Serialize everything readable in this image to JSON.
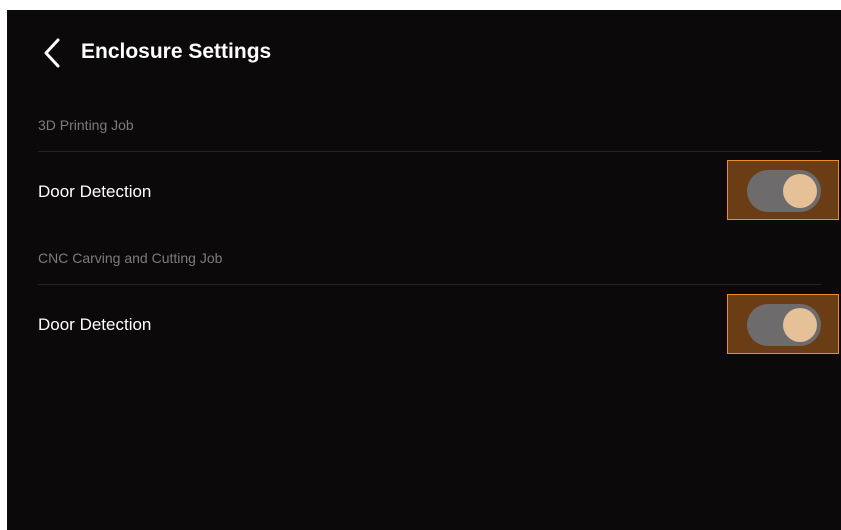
{
  "header": {
    "back_icon": "chevron-left-icon",
    "title": "Enclosure Settings"
  },
  "sections": [
    {
      "label": "3D Printing Job",
      "rows": [
        {
          "label": "Door Detection",
          "toggle_on": true
        }
      ]
    },
    {
      "label": "CNC Carving and Cutting Job",
      "rows": [
        {
          "label": "Door Detection",
          "toggle_on": true
        }
      ]
    }
  ],
  "colors": {
    "background": "#0b090a",
    "text_primary": "#ffffff",
    "text_secondary": "#7d7b7c",
    "toggle_track": "#6e6b6c",
    "toggle_thumb": "#e6c096",
    "highlight_fill": "#6b3d14",
    "highlight_border": "#f28d24"
  }
}
